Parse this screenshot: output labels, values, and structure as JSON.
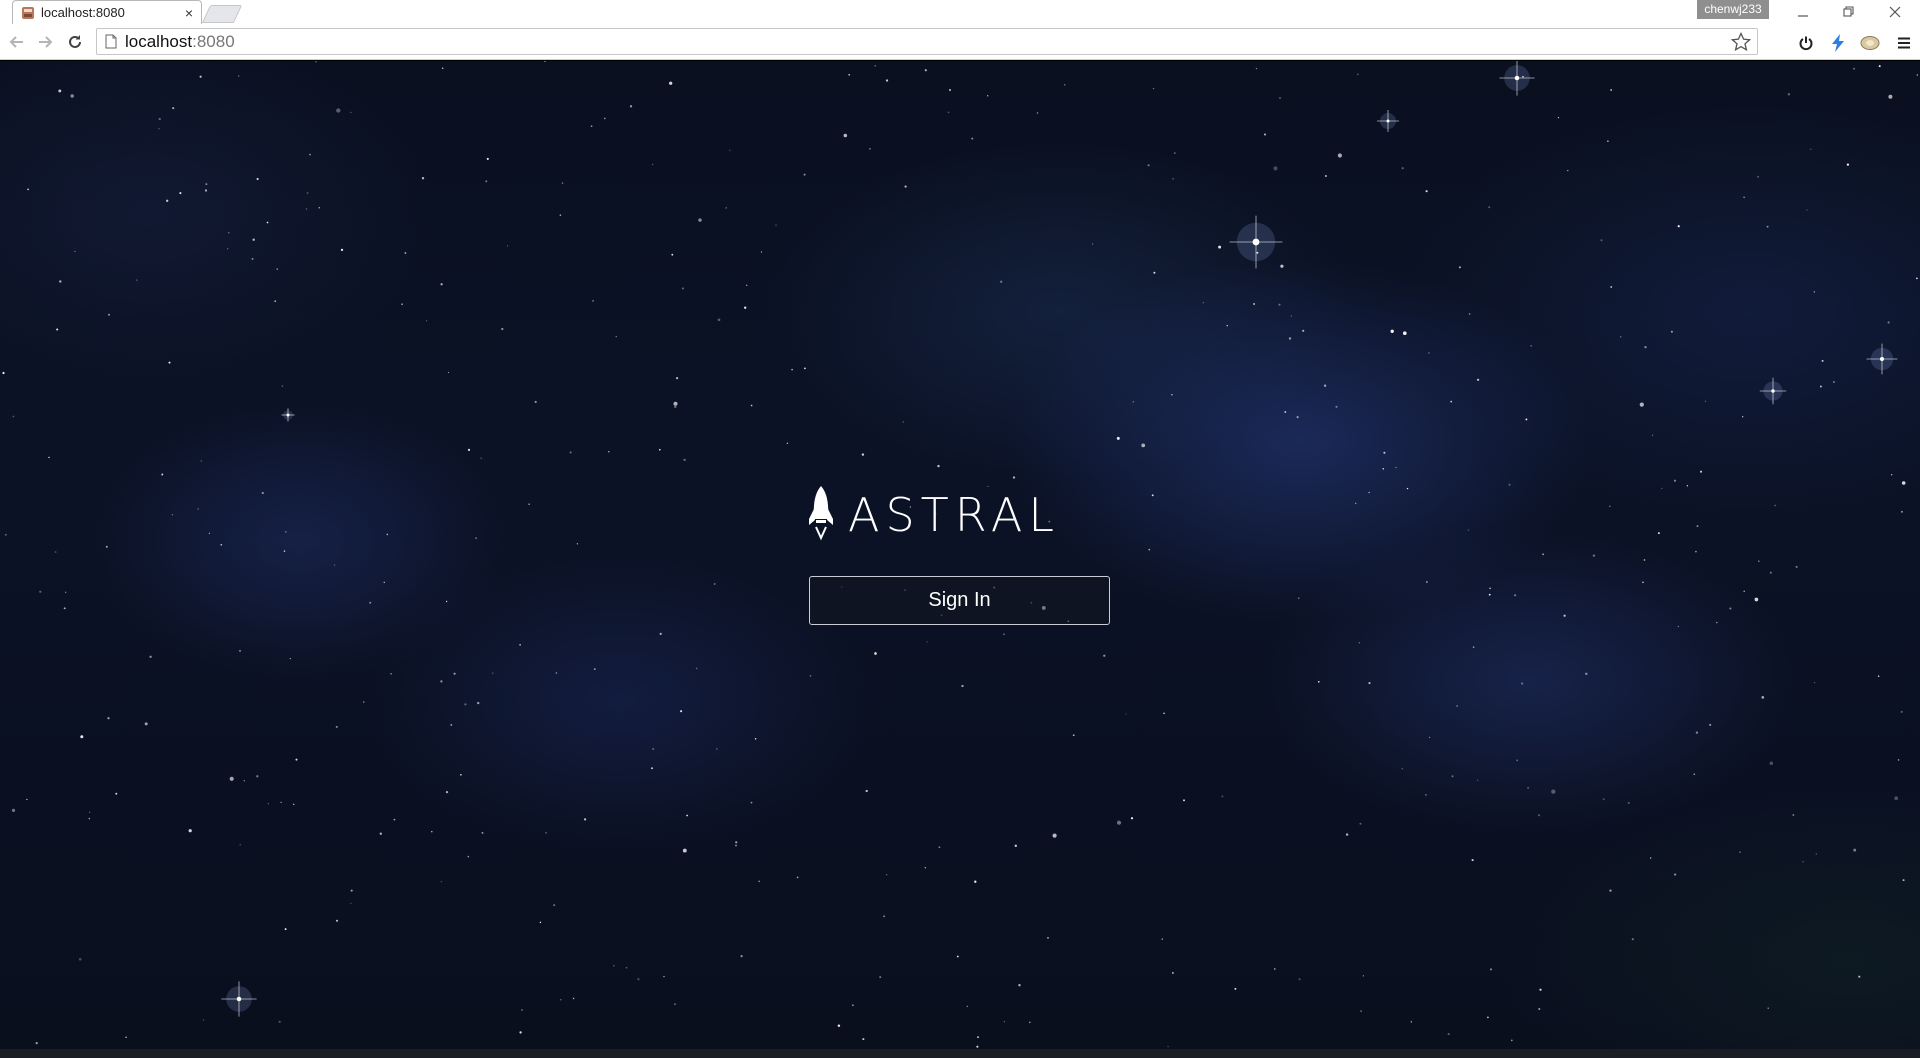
{
  "browser": {
    "tab": {
      "title": "localhost:8080",
      "close_glyph": "×"
    },
    "profile_name": "chenwj233",
    "url": {
      "host": "localhost",
      "port": ":8080"
    },
    "icons": [
      "page-favicon-icon",
      "back-arrow-icon",
      "forward-arrow-icon",
      "reload-icon",
      "page-icon",
      "star-icon",
      "power-icon",
      "lightning-icon",
      "extension-icon",
      "menu-icon",
      "minimize-icon",
      "restore-icon",
      "close-icon"
    ]
  },
  "page": {
    "brand": "ASTRAL",
    "signin_label": "Sign In",
    "background": "starfield"
  },
  "colors": {
    "space_background": "#0a1020",
    "button_border": "#c9ccd4",
    "lightning_accent": "#2f7de1"
  }
}
